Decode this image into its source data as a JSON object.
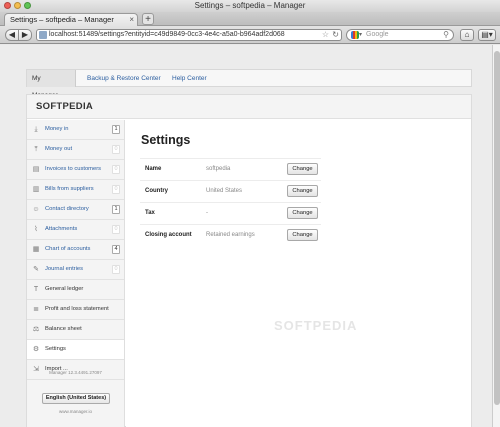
{
  "window": {
    "title": "Settings – softpedia – Manager"
  },
  "tabs": [
    {
      "label": "Settings – softpedia – Manager"
    }
  ],
  "toolbar": {
    "back_glyph": "◀",
    "forward_glyph": "▶",
    "url": "localhost:51489/settings?entityid=c49d9849-0cc3-4e4c-a5a0-b964adf2d068",
    "search_placeholder": "Google",
    "new_tab_glyph": "+",
    "home_glyph": "⌂",
    "menu_glyph": "▤▾"
  },
  "topnav": {
    "items": [
      {
        "label": "My Manager",
        "caret": "▾"
      },
      {
        "label": "Backup & Restore Center"
      },
      {
        "label": "Help Center"
      }
    ]
  },
  "brand": "SOFTPEDIA",
  "sidebar": {
    "items": [
      {
        "label": "Money in",
        "icon": "download-icon",
        "glyph": "⤓",
        "badge": "1",
        "faint": false
      },
      {
        "label": "Money out",
        "icon": "upload-icon",
        "glyph": "⤒",
        "badge": "0",
        "faint": true
      },
      {
        "label": "Invoices to customers",
        "icon": "invoice-icon",
        "glyph": "▤",
        "badge": "0",
        "faint": true
      },
      {
        "label": "Bills from suppliers",
        "icon": "bill-icon",
        "glyph": "▥",
        "badge": "0",
        "faint": true
      },
      {
        "label": "Contact directory",
        "icon": "contacts-icon",
        "glyph": "☺",
        "badge": "1",
        "faint": false
      },
      {
        "label": "Attachments",
        "icon": "paperclip-icon",
        "glyph": "⌇",
        "badge": "0",
        "faint": true
      },
      {
        "label": "Chart of accounts",
        "icon": "chart-icon",
        "glyph": "▦",
        "badge": "4",
        "faint": false
      },
      {
        "label": "Journal entries",
        "icon": "pencil-icon",
        "glyph": "✎",
        "badge": "0",
        "faint": true
      },
      {
        "label": "General ledger",
        "icon": "ledger-icon",
        "glyph": "T",
        "badge": "",
        "faint": true
      },
      {
        "label": "Profit and loss statement",
        "icon": "profit-icon",
        "glyph": "≣",
        "badge": "",
        "faint": true
      },
      {
        "label": "Balance sheet",
        "icon": "balance-icon",
        "glyph": "⚖",
        "badge": "",
        "faint": true
      },
      {
        "label": "Settings",
        "icon": "gear-icon",
        "glyph": "⚙",
        "badge": "",
        "faint": true
      },
      {
        "label": "Import ...",
        "icon": "import-icon",
        "glyph": "⇲",
        "badge": "",
        "faint": true
      }
    ],
    "version": "Manager 12.3.4491.27097",
    "language_button": "English (United States)",
    "site": "www.manager.io"
  },
  "settings": {
    "title": "Settings",
    "change_label": "Change",
    "rows": [
      {
        "name": "Name",
        "value": "softpedia"
      },
      {
        "name": "Country",
        "value": "United States"
      },
      {
        "name": "Tax",
        "value": "-"
      },
      {
        "name": "Closing account",
        "value": "Retained earnings"
      }
    ]
  },
  "watermark": "SOFTPEDIA",
  "colors": {
    "link": "#2a5d9f",
    "traffic_red": "#ee5f57",
    "traffic_yellow": "#f4be4f",
    "traffic_green": "#5fc455"
  }
}
